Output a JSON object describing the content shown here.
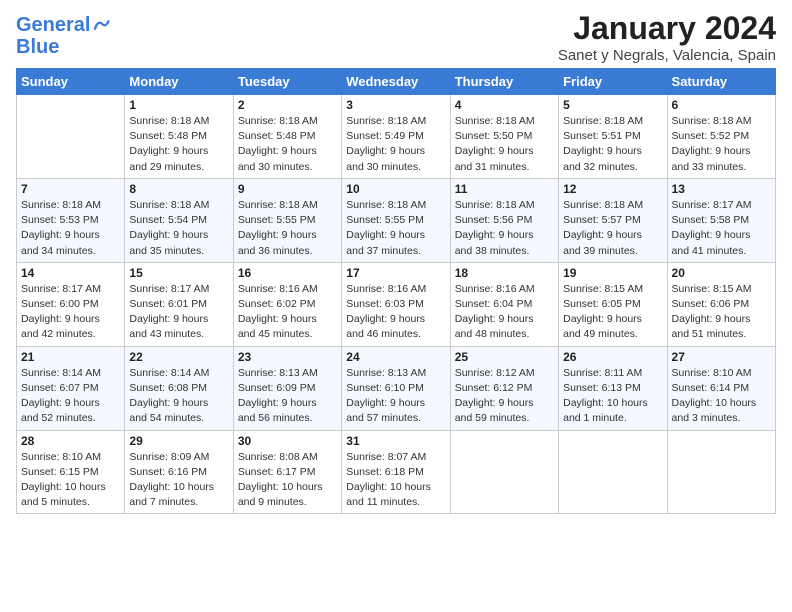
{
  "header": {
    "logo_line1": "General",
    "logo_line2": "Blue",
    "title": "January 2024",
    "subtitle": "Sanet y Negrals, Valencia, Spain"
  },
  "weekdays": [
    "Sunday",
    "Monday",
    "Tuesday",
    "Wednesday",
    "Thursday",
    "Friday",
    "Saturday"
  ],
  "weeks": [
    [
      {
        "day": "",
        "sunrise": "",
        "sunset": "",
        "daylight": ""
      },
      {
        "day": "1",
        "sunrise": "Sunrise: 8:18 AM",
        "sunset": "Sunset: 5:48 PM",
        "daylight": "Daylight: 9 hours and 29 minutes."
      },
      {
        "day": "2",
        "sunrise": "Sunrise: 8:18 AM",
        "sunset": "Sunset: 5:48 PM",
        "daylight": "Daylight: 9 hours and 30 minutes."
      },
      {
        "day": "3",
        "sunrise": "Sunrise: 8:18 AM",
        "sunset": "Sunset: 5:49 PM",
        "daylight": "Daylight: 9 hours and 30 minutes."
      },
      {
        "day": "4",
        "sunrise": "Sunrise: 8:18 AM",
        "sunset": "Sunset: 5:50 PM",
        "daylight": "Daylight: 9 hours and 31 minutes."
      },
      {
        "day": "5",
        "sunrise": "Sunrise: 8:18 AM",
        "sunset": "Sunset: 5:51 PM",
        "daylight": "Daylight: 9 hours and 32 minutes."
      },
      {
        "day": "6",
        "sunrise": "Sunrise: 8:18 AM",
        "sunset": "Sunset: 5:52 PM",
        "daylight": "Daylight: 9 hours and 33 minutes."
      }
    ],
    [
      {
        "day": "7",
        "sunrise": "Sunrise: 8:18 AM",
        "sunset": "Sunset: 5:53 PM",
        "daylight": "Daylight: 9 hours and 34 minutes."
      },
      {
        "day": "8",
        "sunrise": "Sunrise: 8:18 AM",
        "sunset": "Sunset: 5:54 PM",
        "daylight": "Daylight: 9 hours and 35 minutes."
      },
      {
        "day": "9",
        "sunrise": "Sunrise: 8:18 AM",
        "sunset": "Sunset: 5:55 PM",
        "daylight": "Daylight: 9 hours and 36 minutes."
      },
      {
        "day": "10",
        "sunrise": "Sunrise: 8:18 AM",
        "sunset": "Sunset: 5:55 PM",
        "daylight": "Daylight: 9 hours and 37 minutes."
      },
      {
        "day": "11",
        "sunrise": "Sunrise: 8:18 AM",
        "sunset": "Sunset: 5:56 PM",
        "daylight": "Daylight: 9 hours and 38 minutes."
      },
      {
        "day": "12",
        "sunrise": "Sunrise: 8:18 AM",
        "sunset": "Sunset: 5:57 PM",
        "daylight": "Daylight: 9 hours and 39 minutes."
      },
      {
        "day": "13",
        "sunrise": "Sunrise: 8:17 AM",
        "sunset": "Sunset: 5:58 PM",
        "daylight": "Daylight: 9 hours and 41 minutes."
      }
    ],
    [
      {
        "day": "14",
        "sunrise": "Sunrise: 8:17 AM",
        "sunset": "Sunset: 6:00 PM",
        "daylight": "Daylight: 9 hours and 42 minutes."
      },
      {
        "day": "15",
        "sunrise": "Sunrise: 8:17 AM",
        "sunset": "Sunset: 6:01 PM",
        "daylight": "Daylight: 9 hours and 43 minutes."
      },
      {
        "day": "16",
        "sunrise": "Sunrise: 8:16 AM",
        "sunset": "Sunset: 6:02 PM",
        "daylight": "Daylight: 9 hours and 45 minutes."
      },
      {
        "day": "17",
        "sunrise": "Sunrise: 8:16 AM",
        "sunset": "Sunset: 6:03 PM",
        "daylight": "Daylight: 9 hours and 46 minutes."
      },
      {
        "day": "18",
        "sunrise": "Sunrise: 8:16 AM",
        "sunset": "Sunset: 6:04 PM",
        "daylight": "Daylight: 9 hours and 48 minutes."
      },
      {
        "day": "19",
        "sunrise": "Sunrise: 8:15 AM",
        "sunset": "Sunset: 6:05 PM",
        "daylight": "Daylight: 9 hours and 49 minutes."
      },
      {
        "day": "20",
        "sunrise": "Sunrise: 8:15 AM",
        "sunset": "Sunset: 6:06 PM",
        "daylight": "Daylight: 9 hours and 51 minutes."
      }
    ],
    [
      {
        "day": "21",
        "sunrise": "Sunrise: 8:14 AM",
        "sunset": "Sunset: 6:07 PM",
        "daylight": "Daylight: 9 hours and 52 minutes."
      },
      {
        "day": "22",
        "sunrise": "Sunrise: 8:14 AM",
        "sunset": "Sunset: 6:08 PM",
        "daylight": "Daylight: 9 hours and 54 minutes."
      },
      {
        "day": "23",
        "sunrise": "Sunrise: 8:13 AM",
        "sunset": "Sunset: 6:09 PM",
        "daylight": "Daylight: 9 hours and 56 minutes."
      },
      {
        "day": "24",
        "sunrise": "Sunrise: 8:13 AM",
        "sunset": "Sunset: 6:10 PM",
        "daylight": "Daylight: 9 hours and 57 minutes."
      },
      {
        "day": "25",
        "sunrise": "Sunrise: 8:12 AM",
        "sunset": "Sunset: 6:12 PM",
        "daylight": "Daylight: 9 hours and 59 minutes."
      },
      {
        "day": "26",
        "sunrise": "Sunrise: 8:11 AM",
        "sunset": "Sunset: 6:13 PM",
        "daylight": "Daylight: 10 hours and 1 minute."
      },
      {
        "day": "27",
        "sunrise": "Sunrise: 8:10 AM",
        "sunset": "Sunset: 6:14 PM",
        "daylight": "Daylight: 10 hours and 3 minutes."
      }
    ],
    [
      {
        "day": "28",
        "sunrise": "Sunrise: 8:10 AM",
        "sunset": "Sunset: 6:15 PM",
        "daylight": "Daylight: 10 hours and 5 minutes."
      },
      {
        "day": "29",
        "sunrise": "Sunrise: 8:09 AM",
        "sunset": "Sunset: 6:16 PM",
        "daylight": "Daylight: 10 hours and 7 minutes."
      },
      {
        "day": "30",
        "sunrise": "Sunrise: 8:08 AM",
        "sunset": "Sunset: 6:17 PM",
        "daylight": "Daylight: 10 hours and 9 minutes."
      },
      {
        "day": "31",
        "sunrise": "Sunrise: 8:07 AM",
        "sunset": "Sunset: 6:18 PM",
        "daylight": "Daylight: 10 hours and 11 minutes."
      },
      {
        "day": "",
        "sunrise": "",
        "sunset": "",
        "daylight": ""
      },
      {
        "day": "",
        "sunrise": "",
        "sunset": "",
        "daylight": ""
      },
      {
        "day": "",
        "sunrise": "",
        "sunset": "",
        "daylight": ""
      }
    ]
  ]
}
